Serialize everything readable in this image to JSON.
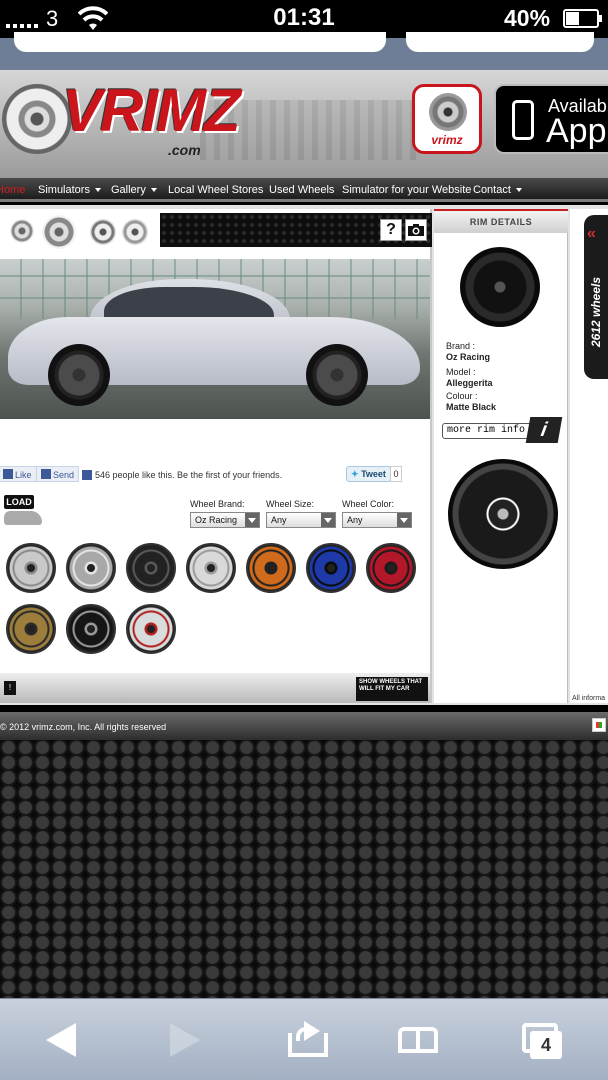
{
  "status_bar": {
    "carrier": "3",
    "time": "01:31",
    "battery": "40%",
    "battery_level": 0.4
  },
  "header": {
    "logo_text": "VRIMZ",
    "logo_domain": ".com",
    "app_icon_label": "vrimz",
    "app_store_line1": "Availab",
    "app_store_line2": "App"
  },
  "nav": {
    "items": [
      {
        "label": "Home"
      },
      {
        "label": "Simulators"
      },
      {
        "label": "Gallery"
      },
      {
        "label": "Local Wheel Stores"
      },
      {
        "label": "Used Wheels"
      },
      {
        "label": "Simulator for your Website"
      },
      {
        "label": "Contact"
      }
    ]
  },
  "simulator": {
    "help_label": "?",
    "social": {
      "like_label": "Like",
      "send_label": "Send",
      "like_count_text": "546 people like this. Be the first of your friends.",
      "tweet_label": "Tweet",
      "tweet_count": "0"
    },
    "load_label": "LOAD",
    "filters": {
      "brand_label": "Wheel Brand:",
      "brand_value": "Oz Racing",
      "size_label": "Wheel Size:",
      "size_value": "Any",
      "color_label": "Wheel Color:",
      "color_value": "Any"
    },
    "wheels": [
      {
        "color": "#c9c9c9",
        "accent": "#8a8a8a"
      },
      {
        "color": "#a8a8a8",
        "accent": "#e5e5e5"
      },
      {
        "color": "#222222",
        "accent": "#5a5a5a"
      },
      {
        "color": "#d9d9d9",
        "accent": "#9a9a9a"
      },
      {
        "color": "#d06a1c",
        "accent": "#222222"
      },
      {
        "color": "#1e39a8",
        "accent": "#0b0b0b"
      },
      {
        "color": "#b3172a",
        "accent": "#1a1a1a"
      },
      {
        "color": "#9c7d3c",
        "accent": "#2a2a2a"
      },
      {
        "color": "#151515",
        "accent": "#9a9a9a"
      },
      {
        "color": "#d8dcdc",
        "accent": "#b12020"
      }
    ],
    "footer_small": "!",
    "show_wheels_label": "SHOW WHEELS THAT WILL FIT MY CAR"
  },
  "rim_details": {
    "heading": "RIM DETAILS",
    "brand_label": "Brand :",
    "brand": "Oz Racing",
    "model_label": "Model :",
    "model": "Alleggerita",
    "colour_label": "Colour :",
    "colour": "Matte Black",
    "more_info_label": "more rim info",
    "info_icon": "i"
  },
  "side_tab": {
    "label": "2612 wheels",
    "chevron": "«",
    "all_info": "All informa"
  },
  "footer": {
    "copyright": "© 2012 vrimz.com, Inc. All rights reserved"
  },
  "toolbar": {
    "tab_count": "4"
  }
}
